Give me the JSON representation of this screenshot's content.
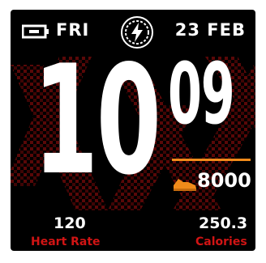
{
  "header": {
    "day": "FRI",
    "date": "23 FEB",
    "battery_icon": "battery-icon",
    "charge_icon": "lightning-icon"
  },
  "time": {
    "hour": "10",
    "minutes": "09"
  },
  "steps": {
    "value": "8000",
    "icon": "shoe-icon"
  },
  "stats": {
    "heart_rate": {
      "value": "120",
      "label": "Heart Rate"
    },
    "calories": {
      "value": "250.3",
      "label": "Calories"
    }
  },
  "colors": {
    "background": "#000000",
    "accent_orange": "#f08a1a",
    "label_red": "#d11414",
    "pattern_red": "#5a0808"
  }
}
